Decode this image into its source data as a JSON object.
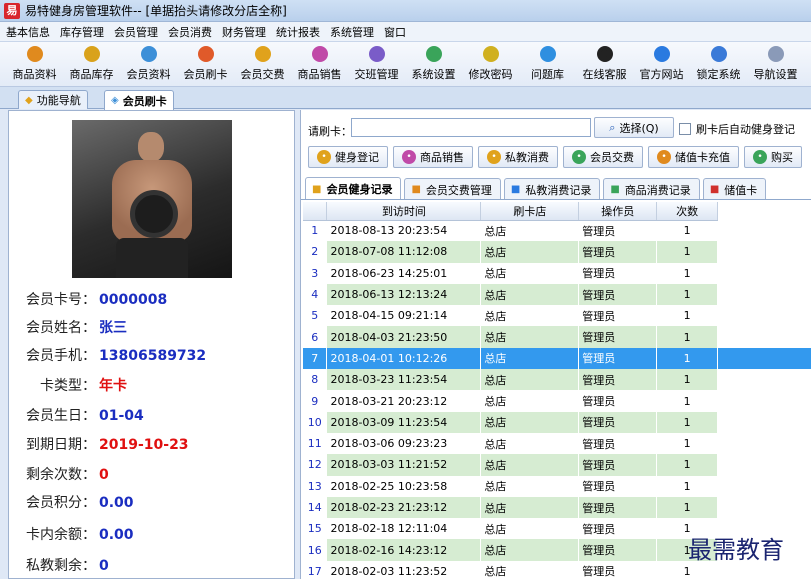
{
  "window": {
    "title": "易特健身房管理软件-- [单据抬头请修改分店全称]"
  },
  "menu": [
    "基本信息",
    "库存管理",
    "会员管理",
    "会员消费",
    "财务管理",
    "统计报表",
    "系统管理",
    "窗口"
  ],
  "toolbar": [
    {
      "label": "商品资料",
      "icon": "box-icon",
      "color": "#e08a1e"
    },
    {
      "label": "商品库存",
      "icon": "warehouse-icon",
      "color": "#d9a21c"
    },
    {
      "label": "会员资料",
      "icon": "member-icon",
      "color": "#3c8fd8"
    },
    {
      "label": "会员刷卡",
      "icon": "card-swipe-icon",
      "color": "#e05a2a"
    },
    {
      "label": "会员交费",
      "icon": "payment-icon",
      "color": "#e0a21c"
    },
    {
      "label": "商品销售",
      "icon": "sales-icon",
      "color": "#c04aa8"
    },
    {
      "label": "交班管理",
      "icon": "handover-icon",
      "color": "#7a5cc8"
    },
    {
      "label": "系统设置",
      "icon": "settings-icon",
      "color": "#3aa45a"
    },
    {
      "label": "修改密码",
      "icon": "password-icon",
      "color": "#d0b020"
    },
    {
      "label": "问题库",
      "icon": "question-icon",
      "color": "#2f8fe0"
    },
    {
      "label": "在线客服",
      "icon": "support-icon",
      "color": "#222222"
    },
    {
      "label": "官方网站",
      "icon": "browser-icon",
      "color": "#2a7ae0"
    },
    {
      "label": "锁定系统",
      "icon": "lock-icon",
      "color": "#3a7ad8"
    },
    {
      "label": "导航设置",
      "icon": "nav-settings-icon",
      "color": "#8a9ab8"
    }
  ],
  "nav_tabs": [
    {
      "label": "功能导航",
      "active": false
    },
    {
      "label": "会员刷卡",
      "active": true
    }
  ],
  "member": {
    "card_no_label": "会员卡号：",
    "card_no": "0000008",
    "name_label": "会员姓名：",
    "name": "张三",
    "phone_label": "会员手机：",
    "phone": "13806589732",
    "card_type_label": "卡类型：",
    "card_type": "年卡",
    "birthday_label": "会员生日：",
    "birthday": "01-04",
    "expiry_label": "到期日期：",
    "expiry": "2019-10-23",
    "remaining_times_label": "剩余次数：",
    "remaining_times": "0",
    "points_label": "会员积分：",
    "points": "0.00",
    "balance_label": "卡内余额：",
    "balance": "0.00",
    "private_label": "私教剩余：",
    "private": "0"
  },
  "swipe": {
    "card_label": "请刷卡：",
    "card_value": "",
    "select_label": "选择(Q)",
    "auto_checkin_label": "刷卡后自动健身登记"
  },
  "actions": [
    {
      "label": "健身登记",
      "icon": "checkin-icon",
      "color": "#e0a21c"
    },
    {
      "label": "商品销售",
      "icon": "sales-icon",
      "color": "#c04aa8"
    },
    {
      "label": "私教消费",
      "icon": "coach-icon",
      "color": "#e0a21c"
    },
    {
      "label": "会员交费",
      "icon": "payment-icon",
      "color": "#3aa45a"
    },
    {
      "label": "储值卡充值",
      "icon": "recharge-icon",
      "color": "#e08a1e"
    },
    {
      "label": "购买",
      "icon": "buy-icon",
      "color": "#3aa45a"
    }
  ],
  "record_tabs": [
    {
      "label": "会员健身记录",
      "active": true
    },
    {
      "label": "会员交费管理",
      "active": false
    },
    {
      "label": "私教消费记录",
      "active": false
    },
    {
      "label": "商品消费记录",
      "active": false
    },
    {
      "label": "储值卡",
      "active": false
    }
  ],
  "table": {
    "columns": [
      "到访时间",
      "刷卡店",
      "操作员",
      "次数"
    ],
    "selected_row": 7,
    "rows": [
      {
        "no": "1",
        "time": "2018-08-13 20:23:54",
        "store": "总店",
        "operator": "管理员",
        "count": "1"
      },
      {
        "no": "2",
        "time": "2018-07-08 11:12:08",
        "store": "总店",
        "operator": "管理员",
        "count": "1"
      },
      {
        "no": "3",
        "time": "2018-06-23 14:25:01",
        "store": "总店",
        "operator": "管理员",
        "count": "1"
      },
      {
        "no": "4",
        "time": "2018-06-13 12:13:24",
        "store": "总店",
        "operator": "管理员",
        "count": "1"
      },
      {
        "no": "5",
        "time": "2018-04-15 09:21:14",
        "store": "总店",
        "operator": "管理员",
        "count": "1"
      },
      {
        "no": "6",
        "time": "2018-04-03 21:23:50",
        "store": "总店",
        "operator": "管理员",
        "count": "1"
      },
      {
        "no": "7",
        "time": "2018-04-01 10:12:26",
        "store": "总店",
        "operator": "管理员",
        "count": "1"
      },
      {
        "no": "8",
        "time": "2018-03-23 11:23:54",
        "store": "总店",
        "operator": "管理员",
        "count": "1"
      },
      {
        "no": "9",
        "time": "2018-03-21 20:23:12",
        "store": "总店",
        "operator": "管理员",
        "count": "1"
      },
      {
        "no": "10",
        "time": "2018-03-09 11:23:54",
        "store": "总店",
        "operator": "管理员",
        "count": "1"
      },
      {
        "no": "11",
        "time": "2018-03-06 09:23:23",
        "store": "总店",
        "operator": "管理员",
        "count": "1"
      },
      {
        "no": "12",
        "time": "2018-03-03 11:21:52",
        "store": "总店",
        "operator": "管理员",
        "count": "1"
      },
      {
        "no": "13",
        "time": "2018-02-25 10:23:58",
        "store": "总店",
        "operator": "管理员",
        "count": "1"
      },
      {
        "no": "14",
        "time": "2018-02-23 21:23:12",
        "store": "总店",
        "operator": "管理员",
        "count": "1"
      },
      {
        "no": "15",
        "time": "2018-02-18 12:11:04",
        "store": "总店",
        "operator": "管理员",
        "count": "1"
      },
      {
        "no": "16",
        "time": "2018-02-16 14:23:12",
        "store": "总店",
        "operator": "管理员",
        "count": "1"
      },
      {
        "no": "17",
        "time": "2018-02-03 11:23:52",
        "store": "总店",
        "operator": "管理员",
        "count": "1"
      }
    ]
  },
  "watermark": "最需教育"
}
